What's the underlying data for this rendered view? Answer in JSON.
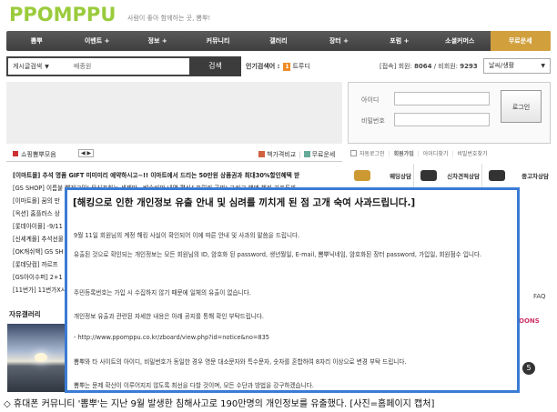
{
  "header": {
    "logo": "PPOMPPU",
    "slogan": "사람이 좋아 함께하는 곳, 뽐뿌!"
  },
  "nav": [
    "뽐뿌",
    "이벤트 +",
    "정보 +",
    "커뮤니티",
    "갤러리",
    "장터 +",
    "포럼 +",
    "소셜커머스",
    "무료운세"
  ],
  "search": {
    "category": "게시글검색",
    "query": "배종원",
    "button": "검색"
  },
  "popular": {
    "label": "인기검색어 :",
    "rank": "1",
    "keyword": "트루디"
  },
  "stats": {
    "prefix": "[접속] 회원: ",
    "members": "8064",
    "middle": " / 비회원: ",
    "guests": "9293"
  },
  "weather_select": "날씨/생활",
  "login": {
    "id_label": "아이디",
    "pw_label": "비밀번호",
    "button": "로그인",
    "auto_login": "자동로그인",
    "join": "회원가입",
    "find_id": "아이디찾기",
    "find_pw": "비밀번호찾기"
  },
  "services": [
    "웨딩상담",
    "신차견적상담",
    "중고차상담"
  ],
  "shop": {
    "title": "쇼핑뽐뿌모음",
    "arrows": "◀ ▶",
    "tab1": "책가격비교",
    "tab2": "무료운세",
    "items": [
      "[이마트몰] 추석 명품 GIFT 미미미리 예약하시고~!! 이마트에서 드리는 50만원 상품권과 최대30%할인혜택 받",
      "[GS SHOP] 이름붙 빨래고민! 무심포하는 세제만.. 배송비만 내면 편심&프릴리 공짜! 그리고 핸맨 혜키 기프트까",
      "[이마트몰] 꿈의 만",
      "[옥션] 홈플러스 상",
      "[롯데아이몰] -9/11",
      "[신세계몰] 추석선물",
      "[OK캐쉬백] GS SH",
      "[롯데닷컴] 까르프",
      "[GS아이수퍼] 2+1",
      "[11번가] 11번가X시"
    ]
  },
  "gallery_title": "자유갤러리",
  "right_fq": "FAQ",
  "right_tag": "OONS",
  "right_circle": "5",
  "popup": {
    "title": "[해킹으로 인한 개인정보 유출 안내 및 심려를 끼치게 된 점 고개 숙여 사과드립니다.]",
    "lines": [
      "9월 11일 회원님의 계정 해킹 사실이 확인되어 이에 따른 안내 및 사과의 말씀을 드립니다.",
      "유출된 것으로 확인되는 개인정보는 모든 회원님의 ID, 암호화 된 password, 생년월일, E-mail, 뽐뿌닉네임, 암호화된 장터 password, 가입일, 회원점수 입니다.",
      "주민등록번호는 가입 시 수집하지 않기 때문에 일체의 유출이 없습니다.",
      "개인정보 유출과 관련된 자세한 내용은 아래 공지를 통해 확인 부탁드립니다.",
      "- http://www.ppomppu.co.kr/zboard/view.php?id=notice&no=835",
      "뽐뿌와 타 사이트의 아이디, 비밀번호가 동일한 경우 영문 대소문자와 특수문자, 숫자를 혼합하여 8자리 이상으로 변경 부탁 드립니다.",
      "뽐뿌는 문제 확산이 이루어지지 않도록 최선을 다할 것이며, 모든 수단과 방법을 강구하겠습니다."
    ]
  },
  "caption": "◇ 휴대폰 커뮤니티 '뽐뿌'는 지난 9월 발생한 침해사고로 190만명의 개인정보를 유출했다. [사진=홈페이지 캡처]",
  "colors": {
    "nav_bg": "#4a4a4a",
    "nav_highlight": "#d1a03d",
    "logo": "#9acb3c",
    "popup_border": "#3a7bd5"
  }
}
